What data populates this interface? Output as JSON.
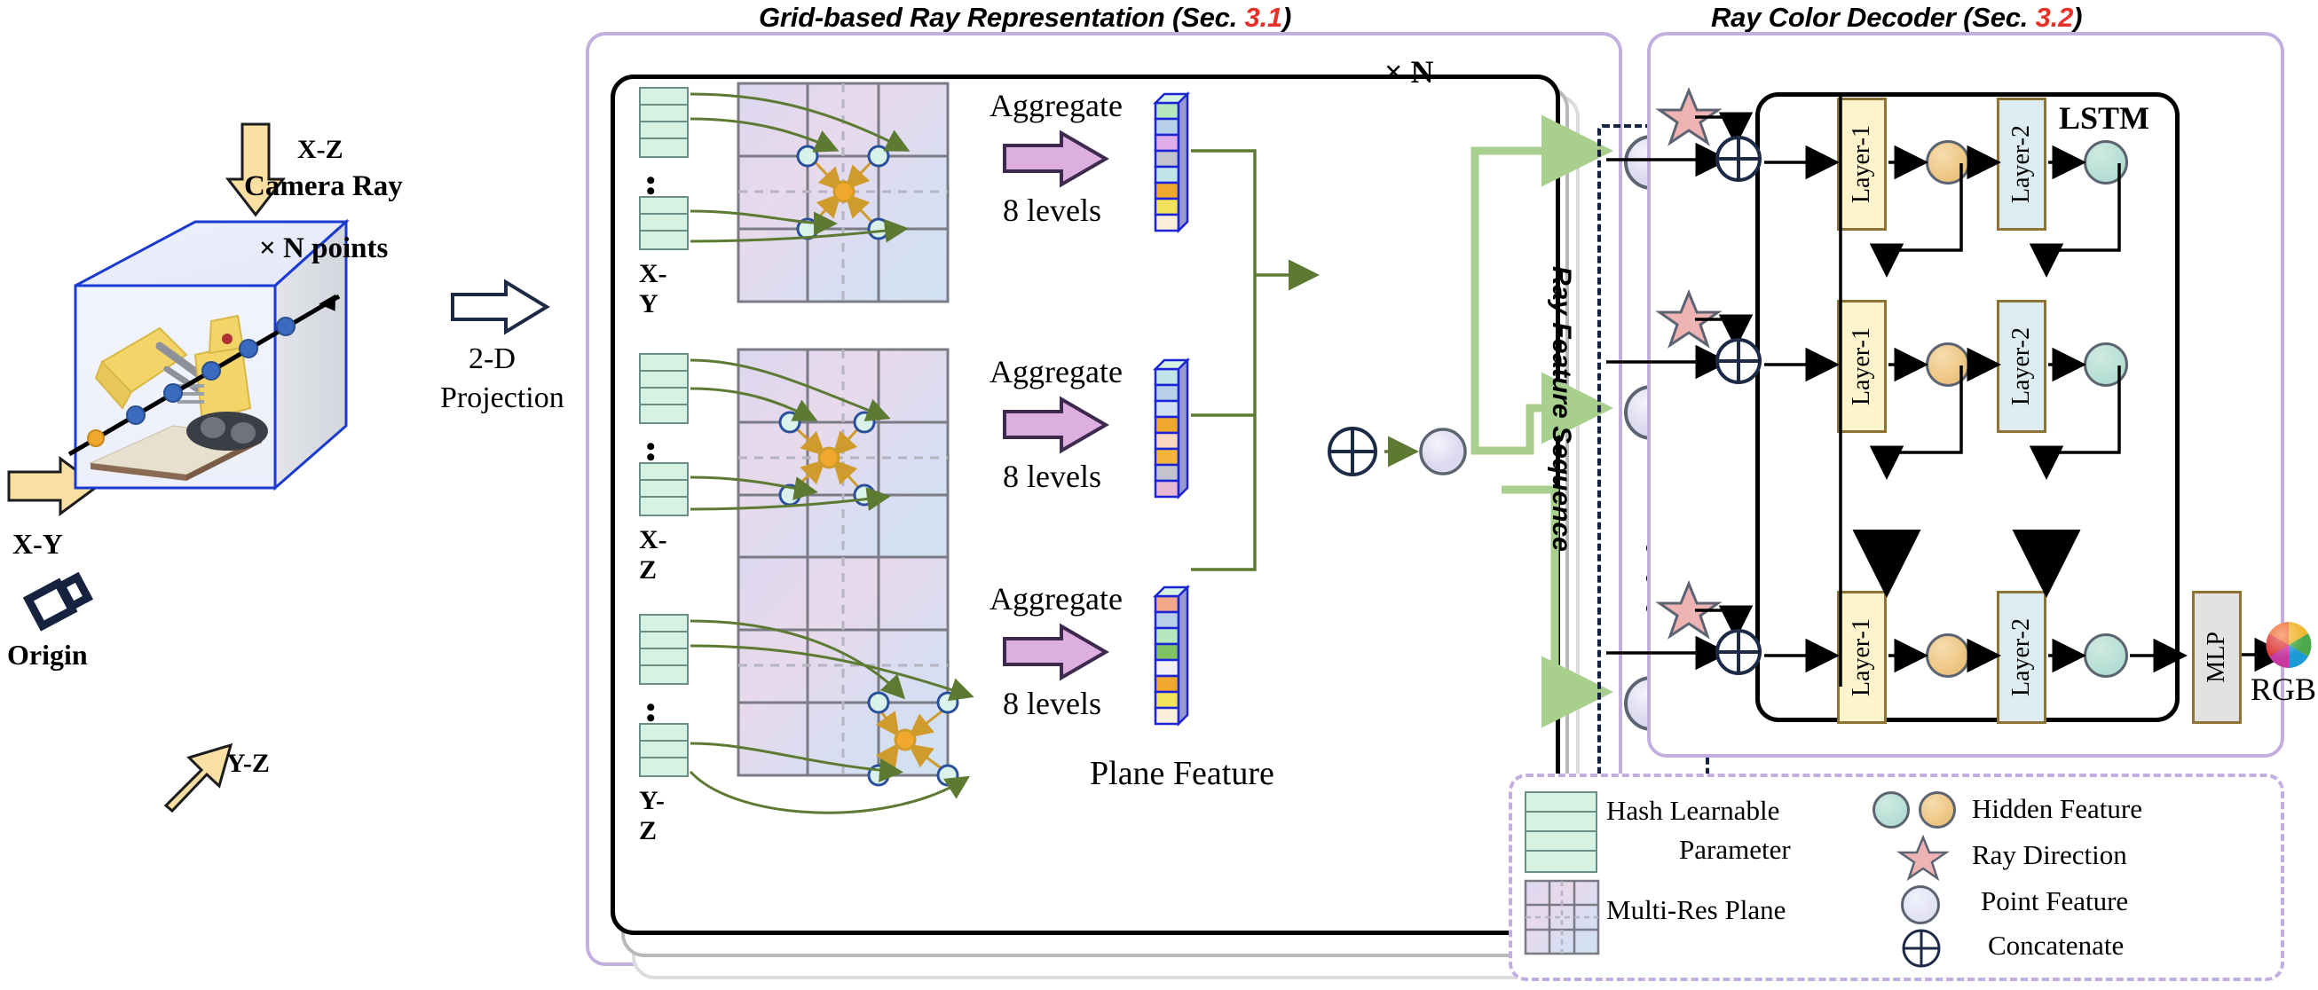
{
  "titles": {
    "left_section": "Grid-based Ray Representation (Sec. ",
    "left_section_num": "3.1",
    "left_section_close": ")",
    "right_section": "Ray Color Decoder (Sec. ",
    "right_section_num": "3.2",
    "right_section_close": ")"
  },
  "scene": {
    "label_xz": "X-Z",
    "label_xy": "X-Y",
    "label_yz": "Y-Z",
    "camera_ray": "Camera Ray",
    "n_points": "× N points",
    "origin": "Origin",
    "projection_line1": "2-D",
    "projection_line2": "Projection"
  },
  "grid_panel": {
    "repeat_badge": "× N",
    "plane_feature_label": "Plane Feature",
    "rows": [
      {
        "plane": "X-Y",
        "aggregate": "Aggregate",
        "levels": "8 levels"
      },
      {
        "plane": "X-Z",
        "aggregate": "Aggregate",
        "levels": "8 levels"
      },
      {
        "plane": "Y-Z",
        "aggregate": "Aggregate",
        "levels": "8 levels"
      }
    ],
    "ellipsis": "• • •"
  },
  "sequence": {
    "label": "Ray Feature Sequence",
    "vertical_dots": "⋮"
  },
  "decoder": {
    "lstm_label": "LSTM",
    "rows": [
      {
        "layer1": "Layer-1",
        "layer2": "Layer-2"
      },
      {
        "layer1": "Layer-1",
        "layer2": "Layer-2"
      },
      {
        "layer1": "Layer-1",
        "layer2": "Layer-2"
      }
    ],
    "mlp": "MLP",
    "rgb": "RGB"
  },
  "legend": {
    "items": [
      {
        "icon": "hash-stack-icon",
        "label": "Hash Learnable"
      },
      {
        "icon": "",
        "label": "Parameter"
      },
      {
        "icon": "multi-res-plane-icon",
        "label": "Multi-Res Plane"
      },
      {
        "icon": "hidden-feature-icon",
        "label": "Hidden Feature"
      },
      {
        "icon": "ray-direction-icon",
        "label": "Ray Direction"
      },
      {
        "icon": "point-feature-icon",
        "label": "Point Feature"
      },
      {
        "icon": "concatenate-icon",
        "label": "Concatenate"
      }
    ]
  },
  "colors": {
    "accent_purple": "#c3aee0",
    "section_num_red": "#e8312a",
    "hash_green": "#d5f2e3",
    "arrow_green": "#5d7a33",
    "link_green": "#a9cf8e",
    "gold": "#d29a2e",
    "layer1_yellow": "#fdf3cd",
    "layer2_blue": "#dcecf0",
    "cube_blue": "#1a3ad0"
  }
}
